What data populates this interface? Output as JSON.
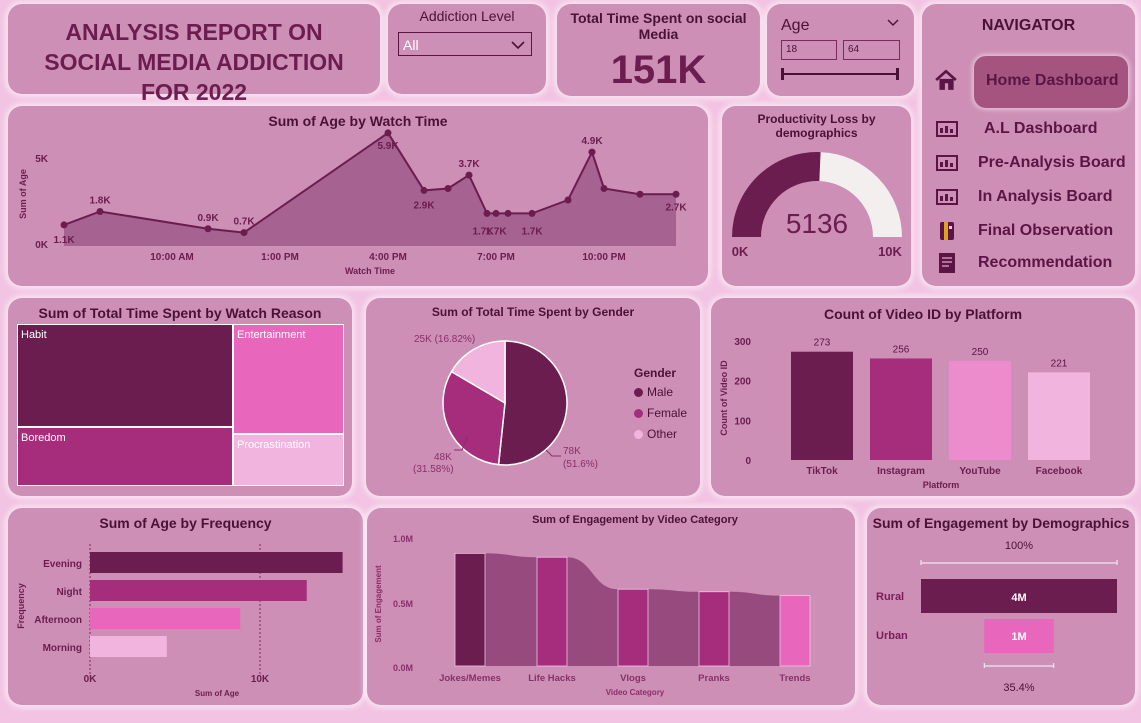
{
  "title": "ANALYSIS REPORT ON SOCIAL MEDIA ADDICTION FOR 2022",
  "filters": {
    "addiction_label": "Addiction Level",
    "addiction_value": "All",
    "age_label": "Age",
    "age_min": "18",
    "age_max": "64"
  },
  "kpi": {
    "label": "Total Time Spent on social Media",
    "value": "151K"
  },
  "navigator": {
    "title": "NAVIGATOR",
    "items": [
      {
        "label": "Home Dashboard",
        "icon": "home-icon"
      },
      {
        "label": "A.L Dashboard",
        "icon": "dashboard-icon"
      },
      {
        "label": "Pre-Analysis Board",
        "icon": "dashboard-icon"
      },
      {
        "label": "In Analysis Board",
        "icon": "dashboard-icon"
      },
      {
        "label": "Final Observation",
        "icon": "book-icon"
      },
      {
        "label": "Recommendation",
        "icon": "report-icon"
      }
    ]
  },
  "colors": {
    "dark": "#6b1d4f",
    "mid": "#a52d7b",
    "pink": "#e866bc",
    "light": "#f0b4de",
    "card": "#cd8fb6"
  },
  "chart_data": [
    {
      "type": "area",
      "title": "Sum of Age by Watch Time",
      "xlabel": "Watch Time",
      "ylabel": "Sum of Age",
      "x_ticks": [
        "10:00 AM",
        "1:00 PM",
        "4:00 PM",
        "7:00 PM",
        "10:00 PM"
      ],
      "y_ticks": [
        "0K",
        "5K"
      ],
      "ylim": [
        0,
        6000
      ],
      "x": [
        "07:00",
        "08:00",
        "11:00",
        "12:00",
        "16:00",
        "17:00",
        "17:40",
        "18:15",
        "18:45",
        "19:00",
        "19:20",
        "20:00",
        "21:00",
        "21:40",
        "22:00",
        "23:00",
        "24:00"
      ],
      "values": [
        1100,
        1800,
        900,
        700,
        5900,
        2900,
        3000,
        3700,
        1700,
        1700,
        1700,
        1700,
        2400,
        4900,
        3000,
        2700,
        2700
      ],
      "labels": [
        "1.1K",
        "1.8K",
        "0.9K",
        "0.7K",
        "5.9K",
        "2.9K",
        "",
        "3.7K",
        "1.7K",
        "1.7K",
        "",
        "1.7K",
        "",
        "4.9K",
        "",
        "",
        "2.7K"
      ]
    },
    {
      "type": "gauge",
      "title": "Productivity Loss by demographics",
      "value": 5136,
      "min": "0K",
      "max": "10K",
      "max_value": 10000
    },
    {
      "type": "treemap",
      "title": "Sum of Total Time Spent by Watch Reason",
      "categories": [
        "Habit",
        "Boredom",
        "Entertainment",
        "Procrastination"
      ],
      "values": [
        42,
        24,
        23,
        11
      ]
    },
    {
      "type": "pie",
      "title": "Sum of Total Time Spent by Gender",
      "legend_title": "Gender",
      "categories": [
        "Male",
        "Female",
        "Other"
      ],
      "values": [
        78,
        48,
        25
      ],
      "percents": [
        51.6,
        31.58,
        16.82
      ],
      "labels": [
        [
          "78K",
          "(51.6%)"
        ],
        [
          "48K",
          "(31.58%)"
        ],
        [
          "25K (16.82%)"
        ]
      ]
    },
    {
      "type": "bar",
      "title": "Count of Video ID by Platform",
      "xlabel": "Platform",
      "ylabel": "Count of Video ID",
      "categories": [
        "TikTok",
        "Instagram",
        "YouTube",
        "Facebook"
      ],
      "values": [
        273,
        256,
        250,
        221
      ],
      "y_ticks": [
        "0",
        "100",
        "200",
        "300"
      ],
      "ylim": [
        0,
        300
      ]
    },
    {
      "type": "bar",
      "orientation": "horizontal",
      "title": "Sum of Age by Frequency",
      "xlabel": "Sum of Age",
      "ylabel": "Frequency",
      "categories": [
        "Evening",
        "Night",
        "Afternoon",
        "Morning"
      ],
      "values": [
        14800,
        12700,
        8800,
        4500
      ],
      "x_ticks": [
        "0K",
        "10K"
      ],
      "xlim": [
        0,
        15000
      ]
    },
    {
      "type": "ribbon",
      "title": "Sum of Engagement by Video Category",
      "xlabel": "Video Category",
      "ylabel": "Sum of Engagement",
      "categories": [
        "Jokes/Memes",
        "Life Hacks",
        "Vlogs",
        "Pranks",
        "Trends"
      ],
      "values": [
        0.88,
        0.85,
        0.6,
        0.58,
        0.55
      ],
      "y_ticks": [
        "0.0M",
        "0.5M",
        "1.0M"
      ],
      "ylim": [
        0,
        1.0
      ]
    },
    {
      "type": "funnel",
      "title": "Sum of Engagement by Demographics",
      "categories": [
        "Rural",
        "Urban"
      ],
      "values": [
        "4M",
        "1M"
      ],
      "top_percent": "100%",
      "bottom_percent": "35.4%",
      "percents": [
        100,
        35.4
      ]
    }
  ]
}
